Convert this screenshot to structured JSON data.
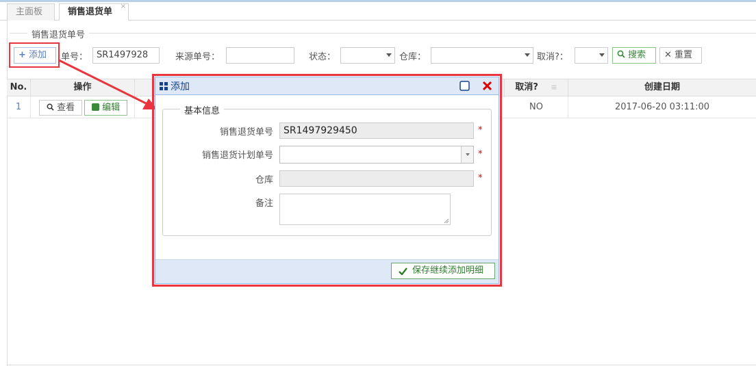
{
  "tabs": [
    {
      "label": "主面板"
    },
    {
      "label": "销售退货单",
      "close": "×"
    }
  ],
  "filter": {
    "legend": "销售退货单号",
    "add_label": "添加",
    "order_no_label": "单号：",
    "order_no_value": "SR1497928",
    "source_no_label": "来源单号：",
    "status_label": "状态：",
    "warehouse_label": "仓库：",
    "cancel_label": "取消?：",
    "search_label": "搜索",
    "reset_label": "重置"
  },
  "grid": {
    "headers": {
      "no": "No.",
      "actions": "操作",
      "cancel": "取消?",
      "created": "创建日期"
    },
    "rows": [
      {
        "no": "1",
        "view": "查看",
        "edit": "编辑",
        "cancel": "NO",
        "created": "2017-06-20 03:11:00"
      }
    ]
  },
  "modal": {
    "title": "添加",
    "fieldset_legend": "基本信息",
    "fields": {
      "return_no_label": "销售退货单号",
      "return_no_value": "SR1497929450",
      "plan_no_label": "销售退货计划单号",
      "warehouse_label": "仓库",
      "remark_label": "备注"
    },
    "required_mark": "*",
    "save_label": "保存继续添加明细"
  },
  "colors": {
    "highlight": "#e9353f",
    "modal_header": "#dfe8f6",
    "title_blue": "#15428b",
    "success": "#2e7d2e"
  }
}
